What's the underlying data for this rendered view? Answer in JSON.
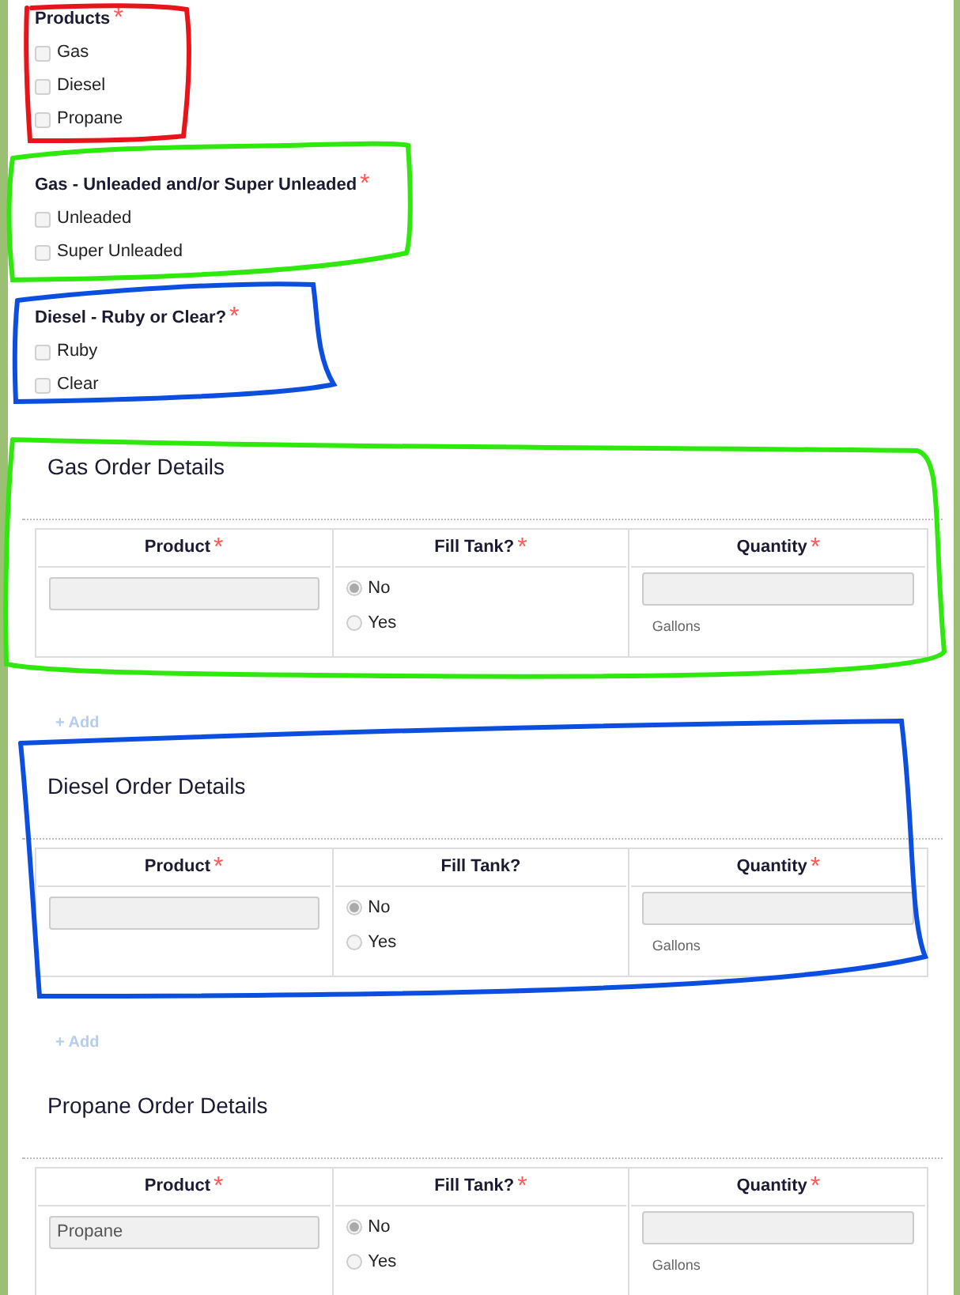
{
  "checkbox_groups": [
    {
      "label": "Products",
      "required_mark": "*",
      "options": [
        {
          "label": "Gas",
          "checked": false
        },
        {
          "label": "Diesel",
          "checked": false
        },
        {
          "label": "Propane",
          "checked": false
        }
      ]
    },
    {
      "label": "Gas - Unleaded and/or Super Unleaded",
      "required_mark": "*",
      "options": [
        {
          "label": "Unleaded",
          "checked": false
        },
        {
          "label": "Super Unleaded",
          "checked": false
        }
      ]
    },
    {
      "label": "Diesel - Ruby or Clear?",
      "required_mark": "*",
      "options": [
        {
          "label": "Ruby",
          "checked": false
        },
        {
          "label": "Clear",
          "checked": false
        }
      ]
    }
  ],
  "order_sections": [
    {
      "title": "Gas Order Details",
      "columns": [
        {
          "label": "Product",
          "required_mark": "*"
        },
        {
          "label": "Fill Tank?",
          "required_mark": "*"
        },
        {
          "label": "Quantity",
          "required_mark": "*"
        }
      ],
      "fill_options": [
        {
          "label": "No",
          "selected": true
        },
        {
          "label": "Yes",
          "selected": false
        }
      ],
      "quantity_unit": "Gallons",
      "add_label": "+ Add"
    },
    {
      "title": "Diesel Order Details",
      "columns": [
        {
          "label": "Product",
          "required_mark": "*"
        },
        {
          "label": "Fill Tank?"
        },
        {
          "label": "Quantity",
          "required_mark": "*"
        }
      ],
      "fill_options": [
        {
          "label": "No",
          "selected": true
        },
        {
          "label": "Yes",
          "selected": false
        }
      ],
      "quantity_unit": "Gallons",
      "add_label": "+ Add"
    },
    {
      "title": "Propane Order Details",
      "columns": [
        {
          "label": "Product",
          "required_mark": "*"
        },
        {
          "label": "Fill Tank?",
          "required_mark": "*"
        },
        {
          "label": "Quantity",
          "required_mark": "*"
        }
      ],
      "product_value": "Propane",
      "fill_options": [
        {
          "label": "No",
          "selected": true
        },
        {
          "label": "Yes",
          "selected": false
        }
      ],
      "quantity_unit": "Gallons"
    }
  ],
  "annotations": [
    {
      "color": "#e8141b"
    },
    {
      "color": "#2ee80e"
    },
    {
      "color": "#0c4ee0"
    },
    {
      "color": "#2ee80e"
    },
    {
      "color": "#0c4ee0"
    }
  ]
}
